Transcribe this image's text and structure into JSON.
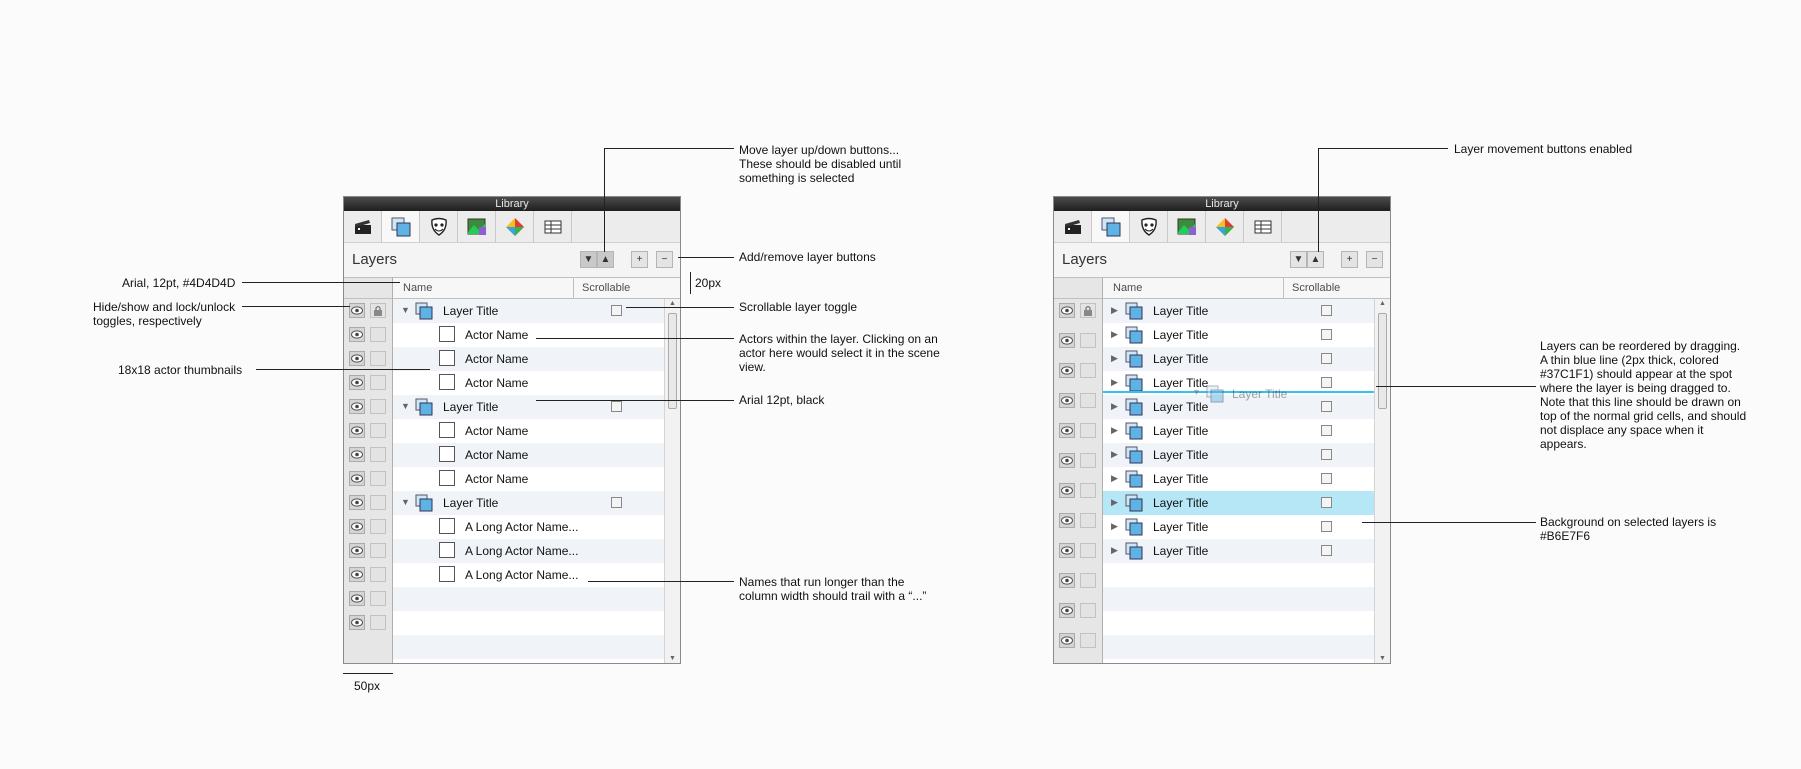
{
  "left_panel": {
    "window_title": "Library",
    "tabs": [
      "scenes-icon",
      "layers-icon",
      "actors-icon",
      "images-icon",
      "behaviors-icon",
      "tables-icon"
    ],
    "section_title": "Layers",
    "move_down_label": "▼",
    "move_up_label": "▲",
    "add_label": "+",
    "remove_label": "−",
    "col_name": "Name",
    "col_scrollable": "Scrollable",
    "rows": [
      {
        "kind": "layer",
        "label": "Layer Title"
      },
      {
        "kind": "actor",
        "label": "Actor Name"
      },
      {
        "kind": "actor",
        "label": "Actor Name"
      },
      {
        "kind": "actor",
        "label": "Actor Name"
      },
      {
        "kind": "layer",
        "label": "Layer Title"
      },
      {
        "kind": "actor",
        "label": "Actor Name"
      },
      {
        "kind": "actor",
        "label": "Actor Name"
      },
      {
        "kind": "actor",
        "label": "Actor Name"
      },
      {
        "kind": "layer",
        "label": "Layer Title"
      },
      {
        "kind": "actor",
        "label": "A Long Actor Name..."
      },
      {
        "kind": "actor",
        "label": "A Long Actor Name..."
      },
      {
        "kind": "actor",
        "label": "A Long Actor Name..."
      }
    ]
  },
  "right_panel": {
    "window_title": "Library",
    "section_title": "Layers",
    "move_down_label": "▼",
    "move_up_label": "▲",
    "add_label": "+",
    "remove_label": "−",
    "col_name": "Name",
    "col_scrollable": "Scrollable",
    "rows": [
      "Layer Title",
      "Layer Title",
      "Layer Title",
      "Layer Title",
      "Layer Title",
      "Layer Title",
      "Layer Title",
      "Layer Title",
      "Layer Title",
      "Layer Title",
      "Layer Title"
    ],
    "selected_row": 8,
    "drag_label": "Layer Title",
    "selected_color": "#B6E7F6",
    "drag_line_color": "#37C1F1"
  },
  "annotations": {
    "move_buttons": "Move layer up/down buttons...\nThese should be disabled until\nsomething is selected",
    "add_remove": "Add/remove layer buttons",
    "font_header": "Arial, 12pt, #4D4D4D",
    "hide_lock": "Hide/show and lock/unlock\ntoggles, respectively",
    "thumbnails": "18x18 actor thumbnails",
    "scrollable_toggle": "Scrollable layer toggle",
    "actors_within": "Actors within the layer. Clicking on an\nactor here would select it in the scene\nview.",
    "font_black": "Arial 12pt, black",
    "long_names": "Names that run longer than the\ncolumn width should trail with a “...”",
    "dim_20px": "20px",
    "dim_50px": "50px",
    "movement_enabled": "Layer movement buttons enabled",
    "reorder": "Layers can be reordered by dragging.\nA thin blue line (2px thick, colored\n#37C1F1) should appear at the spot\nwhere the layer is being dragged to.\nNote that this line should be drawn on\ntop of the normal grid cells, and should\nnot displace any space when it\nappears.",
    "selected_bg": "Background on selected layers is\n#B6E7F6"
  }
}
